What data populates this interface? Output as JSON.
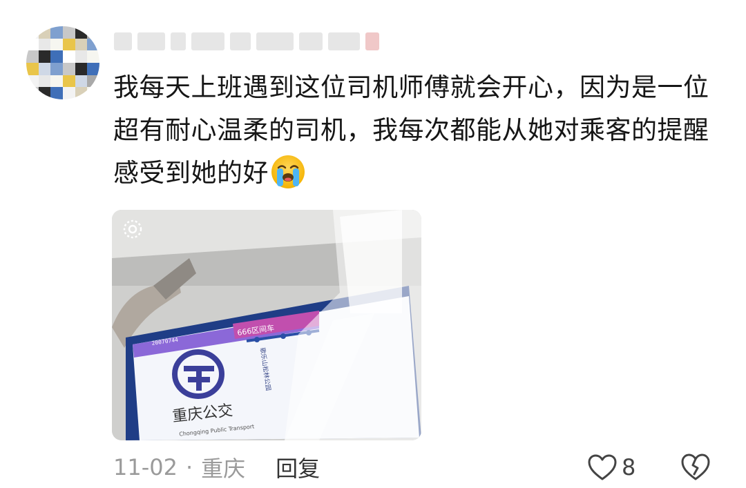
{
  "comment": {
    "text": "我每天上班遇到这位司机师傅就会开心，因为是一位超有耐心温柔的司机，我每次都能从她对乘客的提醒感受到她的好",
    "emoji": "loudly-crying-face"
  },
  "photo": {
    "screen_banner": "666区间车",
    "screen_stop": "歌乐山松林公园",
    "screen_id": "20070744",
    "logo_cn": "重庆公交",
    "logo_en": "Chongqing Public Transport"
  },
  "meta": {
    "date": "11-02",
    "separator": "·",
    "location": "重庆",
    "reply_label": "回复"
  },
  "actions": {
    "like_count": "8",
    "like_icon": "heart-outline-icon",
    "dislike_icon": "broken-heart-icon"
  },
  "colors": {
    "text": "#161616",
    "meta": "#9a9a9a",
    "icon": "#444444"
  }
}
